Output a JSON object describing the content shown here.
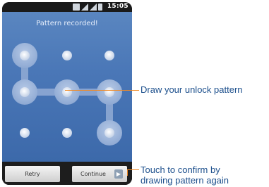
{
  "status_bar": {
    "time": "15:05",
    "icons": [
      "usb-icon",
      "sd-card-icon",
      "signal-icon",
      "battery-icon"
    ]
  },
  "screen": {
    "title": "Pattern recorded!"
  },
  "buttons": {
    "retry": "Retry",
    "continue": "Continue"
  },
  "annotations": {
    "pattern": "Draw your unlock pattern",
    "confirm_line1": "Touch to confirm by",
    "confirm_line2": "drawing pattern again"
  },
  "colors": {
    "screen_bg": "#4a77b7",
    "callout_line": "#f08a26",
    "callout_text": "#1c4f8c"
  }
}
